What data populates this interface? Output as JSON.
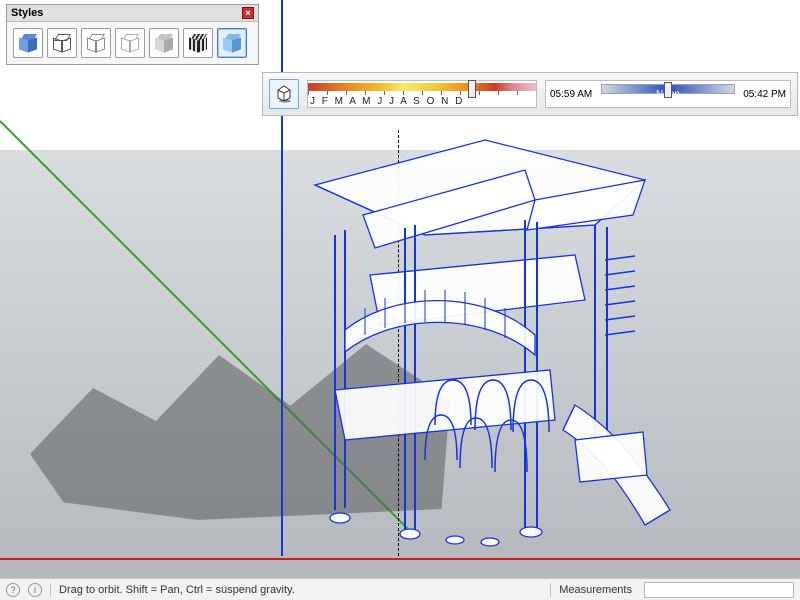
{
  "styles_panel": {
    "title": "Styles",
    "swatches": [
      {
        "name": "shaded-blue",
        "selected": false
      },
      {
        "name": "wireframe",
        "selected": false
      },
      {
        "name": "hidden-line",
        "selected": false
      },
      {
        "name": "monochrome",
        "selected": false
      },
      {
        "name": "shaded-grey",
        "selected": false
      },
      {
        "name": "sketchy-stripes",
        "selected": false
      },
      {
        "name": "xray-blue",
        "selected": true
      }
    ]
  },
  "shadow_toolbar": {
    "month_labels": "J F M A M J J A S O N D",
    "month_knob_pct": 72,
    "time_start": "05:59 AM",
    "time_noon": "Noon",
    "time_end": "05:42 PM",
    "time_knob_pct": 50
  },
  "status": {
    "hint": "Drag to orbit. Shift = Pan, Ctrl = suspend gravity.",
    "measurements_label": "Measurements",
    "measurements_value": ""
  }
}
